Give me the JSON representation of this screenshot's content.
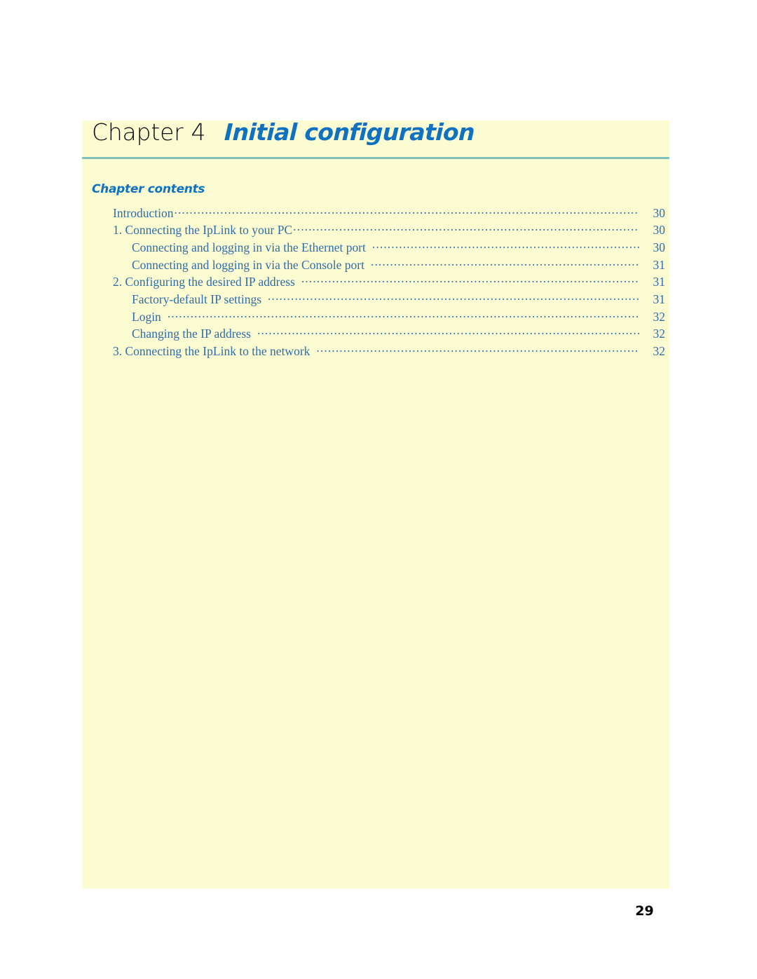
{
  "page": {
    "folio": "29",
    "background_color": "#ffffff",
    "panel_color": "#fcfcd2",
    "rule_color": "#7ec3bb",
    "accent_color": "#0f71c0",
    "toc_text_color": "#2f6da6"
  },
  "chapter": {
    "label": "Chapter",
    "number": "4",
    "heading": "Initial configuration"
  },
  "contents": {
    "heading": "Chapter contents",
    "entries": [
      {
        "text": "Introduction",
        "page": "30",
        "level": 1,
        "gap_before_dots": false
      },
      {
        "text": "1. Connecting the IpLink to your PC",
        "page": "30",
        "level": 1,
        "gap_before_dots": false
      },
      {
        "text": "Connecting and logging in via the Ethernet port",
        "page": "30",
        "level": 2,
        "gap_before_dots": true
      },
      {
        "text": "Connecting and logging in via the Console port",
        "page": "31",
        "level": 2,
        "gap_before_dots": true
      },
      {
        "text": "2. Configuring the desired IP address",
        "page": "31",
        "level": 1,
        "gap_before_dots": true
      },
      {
        "text": "Factory-default IP settings",
        "page": "31",
        "level": 2,
        "gap_before_dots": true
      },
      {
        "text": "Login",
        "page": "32",
        "level": 2,
        "gap_before_dots": true
      },
      {
        "text": "Changing the IP address",
        "page": "32",
        "level": 2,
        "gap_before_dots": true
      },
      {
        "text": "3. Connecting the IpLink to the network",
        "page": "32",
        "level": 1,
        "gap_before_dots": true
      }
    ]
  }
}
